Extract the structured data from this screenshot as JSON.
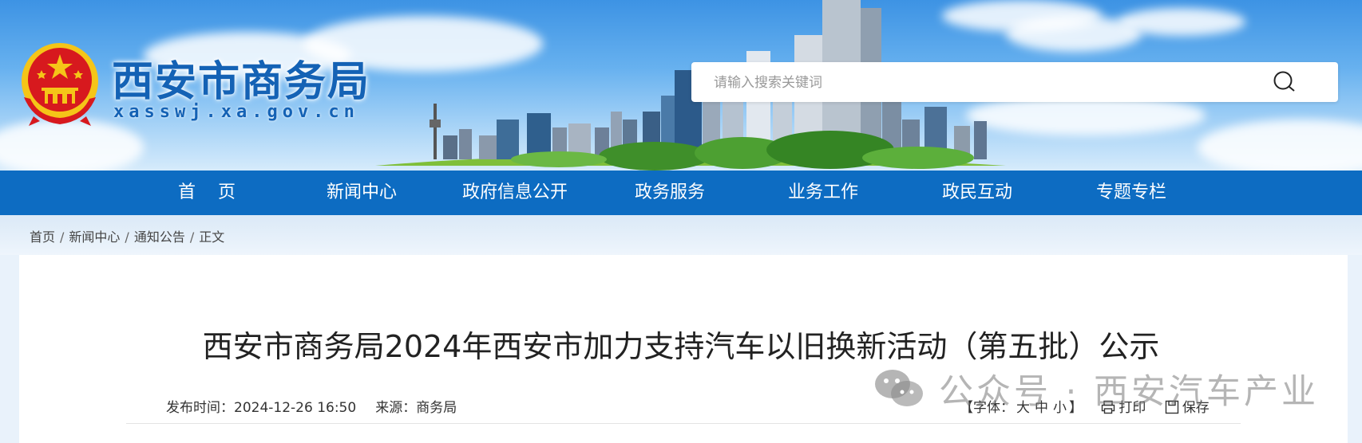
{
  "header": {
    "site_title": "西安市商务局",
    "site_domain": "xasswj.xa.gov.cn"
  },
  "search": {
    "placeholder": "请输入搜索关键词"
  },
  "nav": {
    "items": [
      {
        "label": "首    页"
      },
      {
        "label": "新闻中心"
      },
      {
        "label": "政府信息公开"
      },
      {
        "label": "政务服务"
      },
      {
        "label": "业务工作"
      },
      {
        "label": "政民互动"
      },
      {
        "label": "专题专栏"
      }
    ]
  },
  "breadcrumb": {
    "items": [
      "首页",
      "新闻中心",
      "通知公告",
      "正文"
    ]
  },
  "article": {
    "title": "西安市商务局2024年西安市加力支持汽车以旧换新活动（第五批）公示",
    "publish_label": "发布时间：",
    "publish_time": "2024-12-26 16:50",
    "source_label": "来源：",
    "source": "商务局"
  },
  "tools": {
    "font_open": "【字体：",
    "font_large": "大",
    "font_medium": "中",
    "font_small": "小",
    "font_close": "】",
    "print_label": "打印",
    "save_label": "保存"
  },
  "watermark": {
    "text": "公众号 · 西安汽车产业"
  },
  "colors": {
    "nav_bg": "#0d6cc2",
    "title_blue": "#1462b5",
    "emblem_red": "#d7191e",
    "emblem_gold": "#f5c518"
  }
}
